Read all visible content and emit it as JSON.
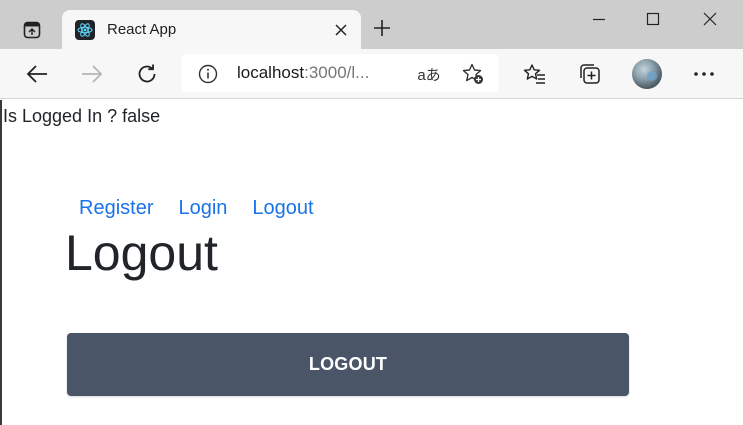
{
  "browser": {
    "tab": {
      "title": "React App"
    },
    "omnibox": {
      "url_host": "localhost",
      "url_rest": ":3000/l...",
      "read_aloud_label": "aあ"
    }
  },
  "page": {
    "status_text": "Is Logged In ? false",
    "nav": {
      "register": "Register",
      "login": "Login",
      "logout": "Logout"
    },
    "title": "Logout",
    "logout_button_label": "LOGOUT"
  },
  "colors": {
    "link": "#1a73e8",
    "button_bg": "#4a5568",
    "titlebar_bg": "#cdcdcd",
    "toolbar_bg": "#f7f7f7"
  },
  "icons": {
    "window_menu": "window-menu-icon",
    "tab_favicon": "react-logo-icon",
    "tab_close": "close-icon",
    "new_tab": "plus-icon",
    "minimize": "minimize-icon",
    "maximize": "maximize-icon",
    "close_window": "close-icon",
    "back": "arrow-left-icon",
    "forward": "arrow-right-icon",
    "refresh": "refresh-icon",
    "site_info": "info-icon",
    "add_favorite": "star-plus-icon",
    "favorites": "favorites-list-icon",
    "collections": "collections-icon",
    "profile": "avatar",
    "more": "more-horizontal-icon"
  }
}
